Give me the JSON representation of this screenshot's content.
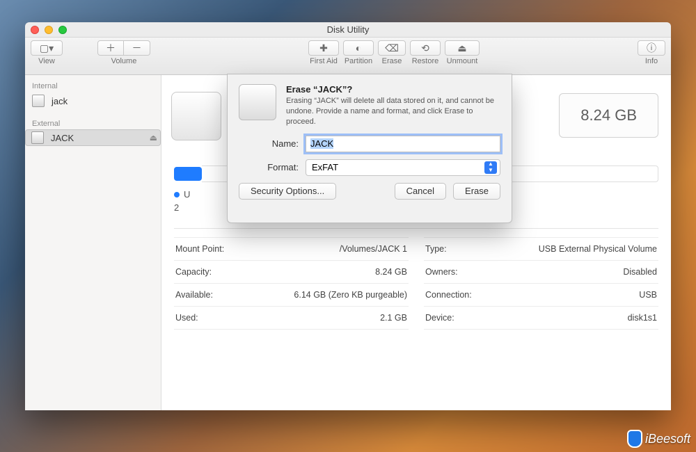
{
  "window": {
    "title": "Disk Utility"
  },
  "toolbar": {
    "view": "View",
    "volume": "Volume",
    "first_aid": "First Aid",
    "partition": "Partition",
    "erase": "Erase",
    "restore": "Restore",
    "unmount": "Unmount",
    "info": "Info"
  },
  "sidebar": {
    "internal_header": "Internal",
    "external_header": "External",
    "internal": [
      {
        "name": "jack"
      }
    ],
    "external": [
      {
        "name": "JACK"
      }
    ]
  },
  "main": {
    "capacity_label": "8.24 GB",
    "bullet_prefix": "U",
    "bullet_num": "2"
  },
  "info": {
    "left": [
      {
        "k": "Mount Point:",
        "v": "/Volumes/JACK 1"
      },
      {
        "k": "Capacity:",
        "v": "8.24 GB"
      },
      {
        "k": "Available:",
        "v": "6.14 GB (Zero KB purgeable)"
      },
      {
        "k": "Used:",
        "v": "2.1 GB"
      }
    ],
    "right": [
      {
        "k": "Type:",
        "v": "USB External Physical Volume"
      },
      {
        "k": "Owners:",
        "v": "Disabled"
      },
      {
        "k": "Connection:",
        "v": "USB"
      },
      {
        "k": "Device:",
        "v": "disk1s1"
      }
    ]
  },
  "sheet": {
    "title": "Erase “JACK”?",
    "body": "Erasing “JACK” will delete all data stored on it, and cannot be undone. Provide a name and format, and click Erase to proceed.",
    "name_label": "Name:",
    "name_value": "JACK",
    "format_label": "Format:",
    "format_value": "ExFAT",
    "security": "Security Options...",
    "cancel": "Cancel",
    "erase": "Erase"
  },
  "watermark": {
    "text": "iBeesoft"
  }
}
